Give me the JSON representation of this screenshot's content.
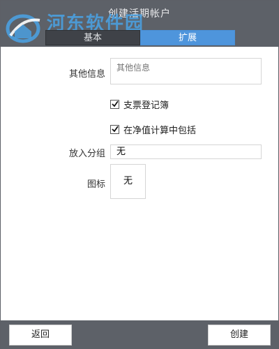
{
  "window": {
    "title": "创建活期帐户"
  },
  "watermark": {
    "text": "河东软件园",
    "url": "www.pc0359.cn"
  },
  "tabs": [
    {
      "label": "基本",
      "active": false
    },
    {
      "label": "扩展",
      "active": true
    }
  ],
  "form": {
    "other_info": {
      "label": "其他信息",
      "placeholder": "其他信息",
      "value": ""
    },
    "checkbook": {
      "label": "支票登记簿",
      "checked": true
    },
    "net_worth": {
      "label": "在净值计算中包括",
      "checked": true
    },
    "group": {
      "label": "放入分组",
      "value": "无"
    },
    "icon": {
      "label": "图标",
      "value": "无"
    }
  },
  "footer": {
    "back_label": "返回",
    "create_label": "创建"
  },
  "colors": {
    "titlebar": "#5d6168",
    "tab_active": "#4e95dc",
    "tab_inactive": "#3f4248",
    "footer": "#5d6168"
  }
}
